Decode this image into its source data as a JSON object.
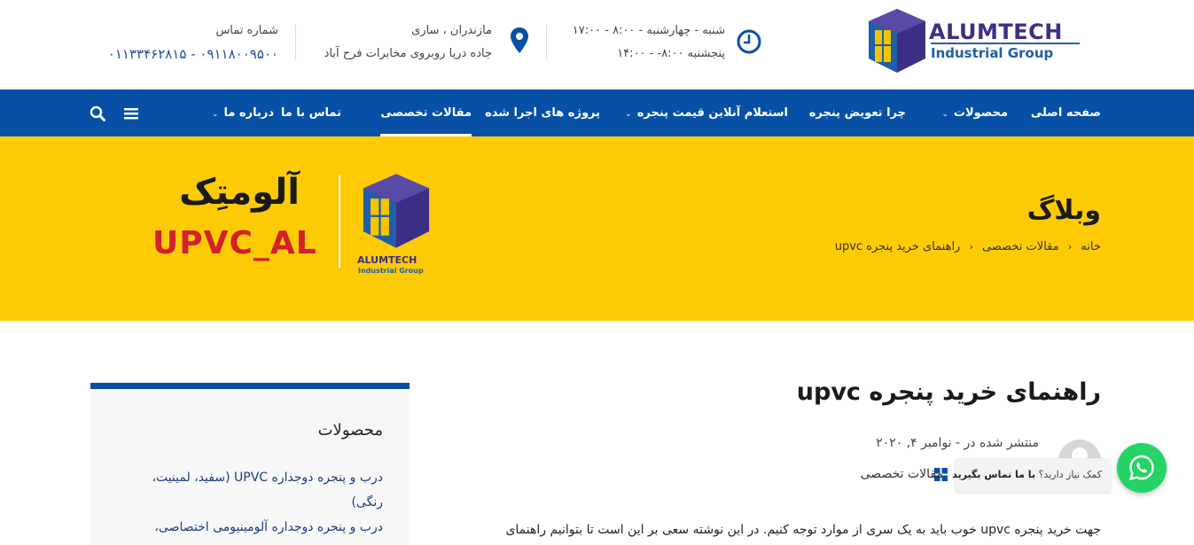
{
  "header": {
    "logo_line1": "ALUMTECH",
    "logo_line2": "Industrial Group",
    "hours_line1": "شنبه - چهارشنبه - ۸:۰۰ - ۱۷:۰۰",
    "hours_line2": "پنجشنبه ۸:۰۰- - ۱۴:۰۰",
    "address_line1": "مازندران ، ساری",
    "address_line2": "جاده دریا روبروی مخابرات فرح آباد",
    "phone_label": "شماره تماس",
    "phone_numbers": "۰۱۱۳۳۴۶۲۸۱۵ - ۰۹۱۱۸۰۰۹۵۰۰"
  },
  "nav": {
    "items": [
      {
        "label": "صفحه اصلی"
      },
      {
        "label": "محصولات"
      },
      {
        "label": "چرا تعویض پنجره"
      },
      {
        "label": "استعلام آنلاین قیمت پنجره"
      },
      {
        "label": "پروژه های اجرا شده"
      },
      {
        "label": "مقالات تخصصی"
      },
      {
        "label": "تماس با ما"
      },
      {
        "label": "درباره ما"
      }
    ],
    "chevron": "⌄"
  },
  "hero": {
    "title": "وبلاگ",
    "breadcrumb": [
      "خانه",
      "مقالات تخصصی",
      "راهنمای خرید پنجره upvc"
    ],
    "crumb_sep": "‹",
    "brand_fa": "آلومتِک",
    "brand_en": "UPVC_AL",
    "brand_logo_line1": "ALUMTECH",
    "brand_logo_line2": "Industrial Group"
  },
  "sidebar": {
    "title": "محصولات",
    "links": [
      "درب و پنجره دوجداره UPVC (سفید، لمینیت، رنگی)",
      "درب و پنجره دوجداره آلومینیومی اختصاصی،"
    ]
  },
  "post": {
    "title": "راهنمای خرید پنجره upvc",
    "published": "منتشر شده در - نوامبر ۴, ۲۰۲۰",
    "category": "مقالات تخصصی",
    "text_start": "جهت خرید پنجره upvc  خوب باید به یک سری از موارد توجه کنیم. در این نوشته سعی بر این است تا بتوانیم راهنمای"
  },
  "whatsapp": {
    "prompt": "کمک نیاز دارید؟",
    "cta": "با ما تماس بگیرید"
  },
  "colors": {
    "nav_blue": "#0750a6",
    "hero_yellow": "#fccb05",
    "whatsapp_green": "#25d366"
  }
}
